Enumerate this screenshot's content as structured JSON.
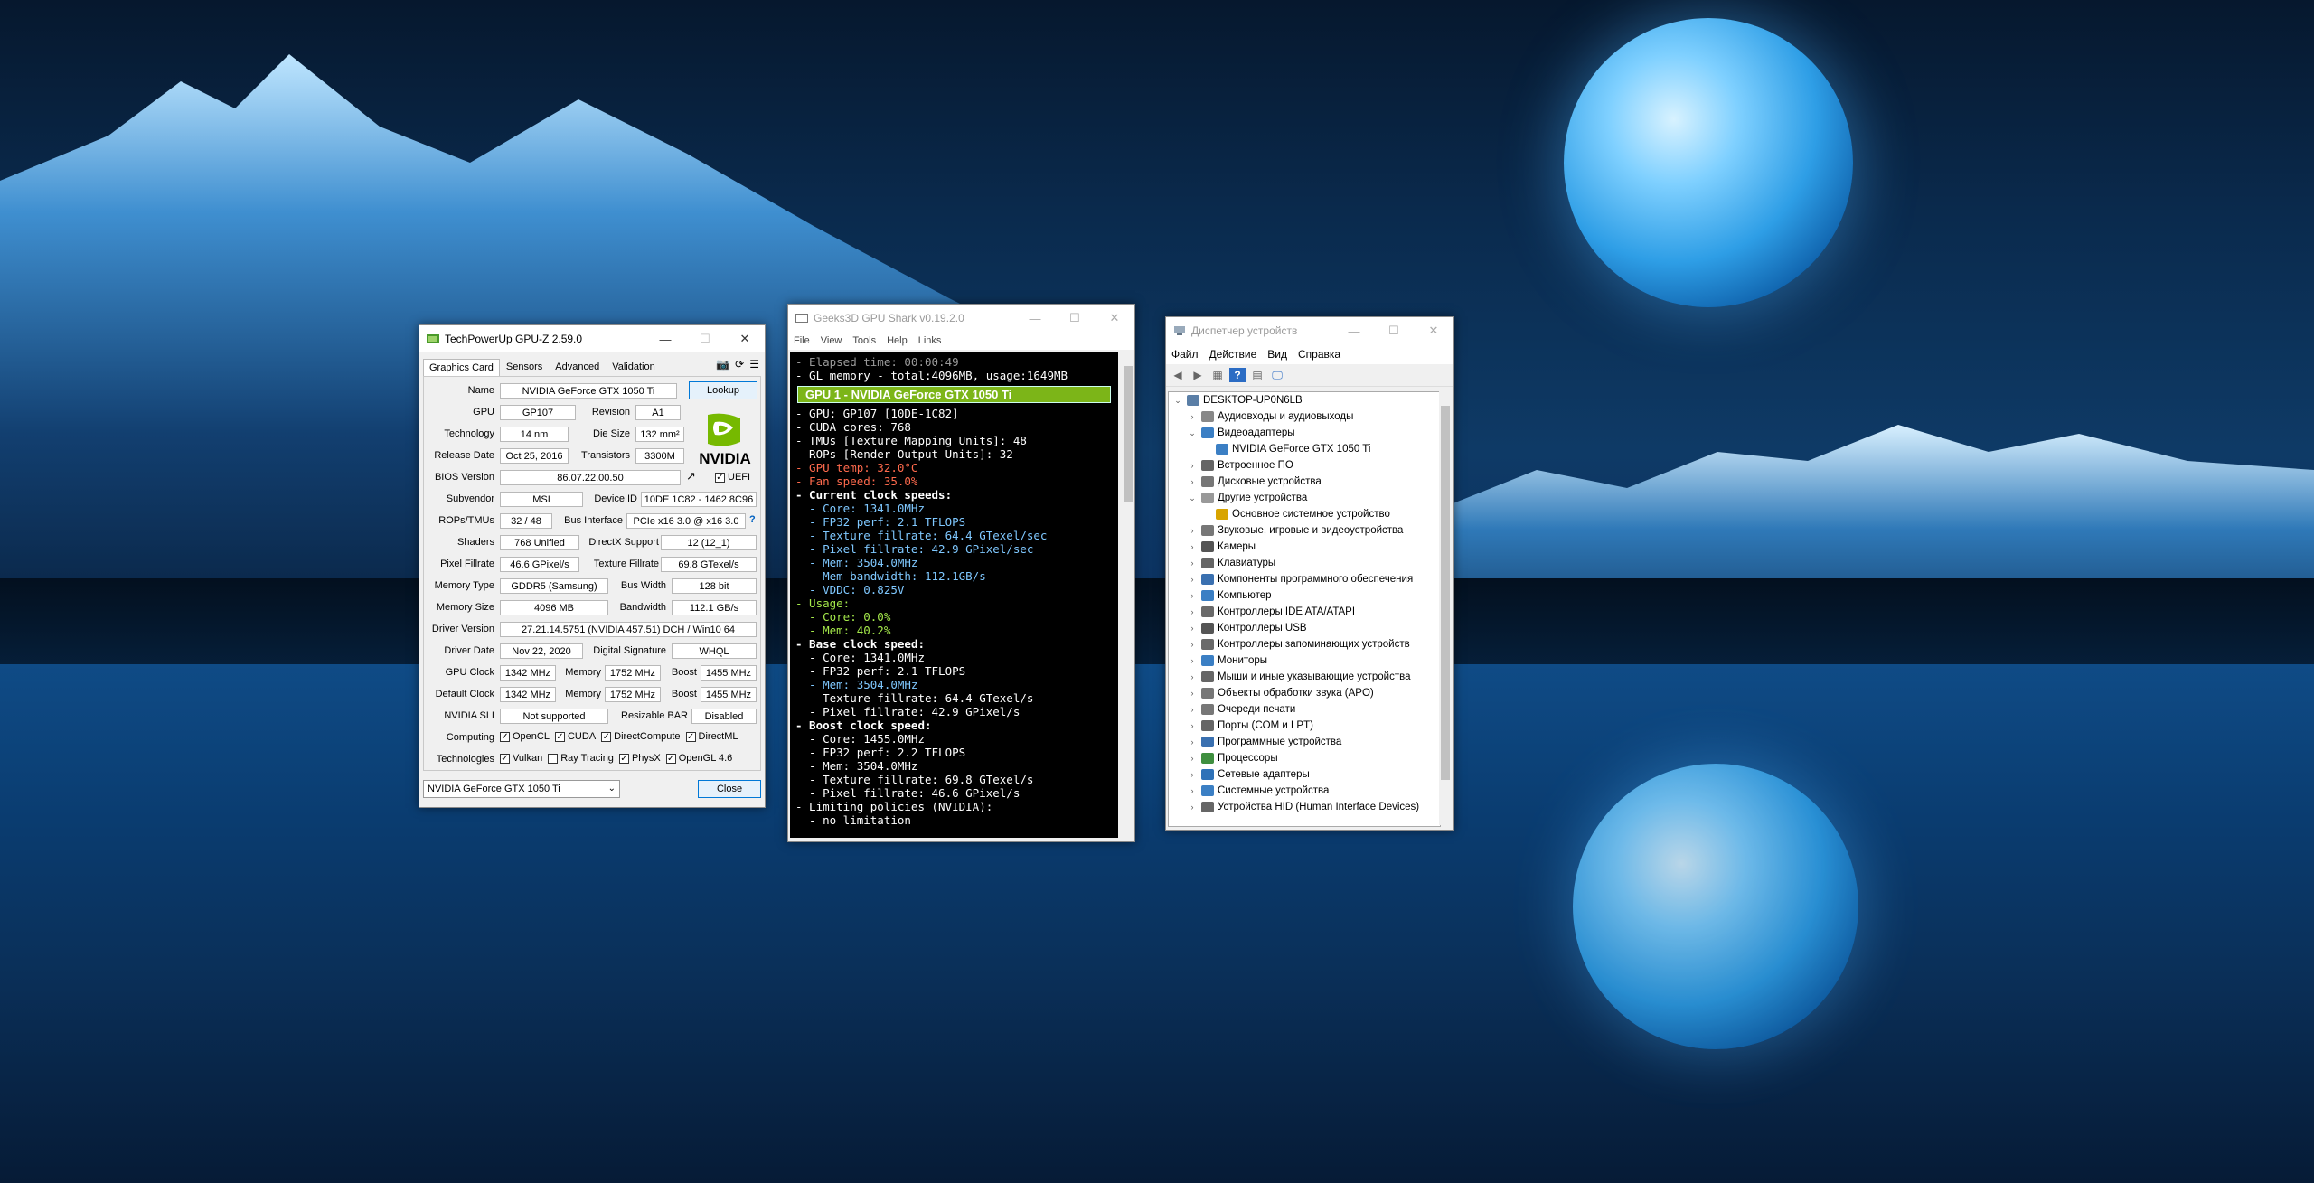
{
  "gpuz": {
    "title": "TechPowerUp GPU-Z 2.59.0",
    "tabs": [
      "Graphics Card",
      "Sensors",
      "Advanced",
      "Validation"
    ],
    "lookup_label": "Lookup",
    "logo_text": "NVIDIA",
    "fields": {
      "name_label": "Name",
      "name": "NVIDIA GeForce GTX 1050 Ti",
      "gpu_label": "GPU",
      "gpu": "GP107",
      "revision_label": "Revision",
      "revision": "A1",
      "technology_label": "Technology",
      "technology": "14 nm",
      "die_size_label": "Die Size",
      "die_size": "132 mm²",
      "release_label": "Release Date",
      "release": "Oct 25, 2016",
      "transistors_label": "Transistors",
      "transistors": "3300M",
      "bios_label": "BIOS Version",
      "bios": "86.07.22.00.50",
      "uefi_label": "UEFI",
      "subvendor_label": "Subvendor",
      "subvendor": "MSI",
      "device_id_label": "Device ID",
      "device_id": "10DE 1C82 - 1462 8C96",
      "rops_label": "ROPs/TMUs",
      "rops": "32 / 48",
      "bus_label": "Bus Interface",
      "bus": "PCIe x16 3.0 @ x16 3.0",
      "help_glyph": "?",
      "shaders_label": "Shaders",
      "shaders": "768 Unified",
      "directx_label": "DirectX Support",
      "directx": "12 (12_1)",
      "pixel_label": "Pixel Fillrate",
      "pixel": "46.6 GPixel/s",
      "texture_label": "Texture Fillrate",
      "texture": "69.8 GTexel/s",
      "memtype_label": "Memory Type",
      "memtype": "GDDR5 (Samsung)",
      "buswidth_label": "Bus Width",
      "buswidth": "128 bit",
      "memsize_label": "Memory Size",
      "memsize": "4096 MB",
      "bandwidth_label": "Bandwidth",
      "bandwidth": "112.1 GB/s",
      "driver_label": "Driver Version",
      "driver": "27.21.14.5751 (NVIDIA 457.51) DCH / Win10 64",
      "driverdate_label": "Driver Date",
      "driverdate": "Nov 22, 2020",
      "digsig_label": "Digital Signature",
      "digsig": "WHQL",
      "gpuclock_label": "GPU Clock",
      "gpuclock": "1342 MHz",
      "memory_label": "Memory",
      "memclock": "1752 MHz",
      "boost_label": "Boost",
      "boost": "1455 MHz",
      "defclock_label": "Default Clock",
      "defclock": "1342 MHz",
      "defmem": "1752 MHz",
      "defboost": "1455 MHz",
      "sli_label": "NVIDIA SLI",
      "sli": "Not supported",
      "bar_label": "Resizable BAR",
      "bar": "Disabled",
      "computing_label": "Computing",
      "technologies_label": "Technologies"
    },
    "computing": [
      {
        "label": "OpenCL",
        "checked": true
      },
      {
        "label": "CUDA",
        "checked": true
      },
      {
        "label": "DirectCompute",
        "checked": true
      },
      {
        "label": "DirectML",
        "checked": true
      }
    ],
    "technologies": [
      {
        "label": "Vulkan",
        "checked": true
      },
      {
        "label": "Ray Tracing",
        "checked": false
      },
      {
        "label": "PhysX",
        "checked": true
      },
      {
        "label": "OpenGL 4.6",
        "checked": true
      }
    ],
    "select_value": "NVIDIA GeForce GTX 1050 Ti",
    "close_label": "Close"
  },
  "shark": {
    "title": "Geeks3D GPU Shark v0.19.2.0",
    "menu": [
      "File",
      "View",
      "Tools",
      "Help",
      "Links"
    ],
    "lines_top": [
      {
        "text": "- Elapsed time: 00:00:49",
        "color": "#9a9a9a"
      },
      {
        "text": "- GL memory - total:4096MB, usage:1649MB",
        "color": "#ffffff"
      }
    ],
    "banner": "GPU 1 - NVIDIA GeForce GTX 1050 Ti",
    "lines": [
      {
        "text": "- GPU: GP107 [10DE-1C82]",
        "color": "#ffffff"
      },
      {
        "text": "- CUDA cores: 768",
        "color": "#ffffff"
      },
      {
        "text": "- TMUs [Texture Mapping Units]: 48",
        "color": "#ffffff"
      },
      {
        "text": "- ROPs [Render Output Units]: 32",
        "color": "#ffffff"
      },
      {
        "text": "- GPU temp: 32.0°C",
        "color": "#ff6a4d"
      },
      {
        "text": "- Fan speed: 35.0%",
        "color": "#ff6a4d"
      },
      {
        "text": "- Current clock speeds:",
        "color": "#ffffff",
        "bold": true
      },
      {
        "text": "  - Core: 1341.0MHz",
        "color": "#7fc8ff"
      },
      {
        "text": "  - FP32 perf: 2.1 TFLOPS",
        "color": "#7fc8ff"
      },
      {
        "text": "  - Texture fillrate: 64.4 GTexel/sec",
        "color": "#7fc8ff"
      },
      {
        "text": "  - Pixel fillrate: 42.9 GPixel/sec",
        "color": "#7fc8ff"
      },
      {
        "text": "  - Mem: 3504.0MHz",
        "color": "#7fc8ff"
      },
      {
        "text": "  - Mem bandwidth: 112.1GB/s",
        "color": "#7fc8ff"
      },
      {
        "text": "  - VDDC: 0.825V",
        "color": "#7fc8ff"
      },
      {
        "text": "- Usage:",
        "color": "#a4e84a"
      },
      {
        "text": "  - Core: 0.0%",
        "color": "#a4e84a"
      },
      {
        "text": "  - Mem: 40.2%",
        "color": "#a4e84a"
      },
      {
        "text": "- Base clock speed:",
        "color": "#ffffff",
        "bold": true
      },
      {
        "text": "  - Core: 1341.0MHz",
        "color": "#ffffff"
      },
      {
        "text": "  - FP32 perf: 2.1 TFLOPS",
        "color": "#ffffff"
      },
      {
        "text": "  - Mem: 3504.0MHz",
        "color": "#7fc8ff"
      },
      {
        "text": "  - Texture fillrate: 64.4 GTexel/s",
        "color": "#ffffff"
      },
      {
        "text": "  - Pixel fillrate: 42.9 GPixel/s",
        "color": "#ffffff"
      },
      {
        "text": "- Boost clock speed:",
        "color": "#ffffff",
        "bold": true
      },
      {
        "text": "  - Core: 1455.0MHz",
        "color": "#ffffff"
      },
      {
        "text": "  - FP32 perf: 2.2 TFLOPS",
        "color": "#ffffff"
      },
      {
        "text": "  - Mem: 3504.0MHz",
        "color": "#ffffff"
      },
      {
        "text": "  - Texture fillrate: 69.8 GTexel/s",
        "color": "#ffffff"
      },
      {
        "text": "  - Pixel fillrate: 46.6 GPixel/s",
        "color": "#ffffff"
      },
      {
        "text": "- Limiting policies (NVIDIA):",
        "color": "#ffffff"
      },
      {
        "text": "  - no limitation",
        "color": "#ffffff"
      }
    ]
  },
  "devmgr": {
    "title": "Диспетчер устройств",
    "menu": [
      "Файл",
      "Действие",
      "Вид",
      "Справка"
    ],
    "tree": [
      {
        "label": "DESKTOP-UP0N6LB",
        "level": 0,
        "exp": "v",
        "icon": "computer-icon"
      },
      {
        "label": "Аудиовходы и аудиовыходы",
        "level": 1,
        "exp": ">",
        "icon": "audio-icon"
      },
      {
        "label": "Видеоадаптеры",
        "level": 1,
        "exp": "v",
        "icon": "display-adapter-icon"
      },
      {
        "label": "NVIDIA GeForce GTX 1050 Ti",
        "level": 2,
        "exp": "",
        "icon": "display-adapter-icon"
      },
      {
        "label": "Встроенное ПО",
        "level": 1,
        "exp": ">",
        "icon": "firmware-icon"
      },
      {
        "label": "Дисковые устройства",
        "level": 1,
        "exp": ">",
        "icon": "disk-icon"
      },
      {
        "label": "Другие устройства",
        "level": 1,
        "exp": "v",
        "icon": "other-device-icon"
      },
      {
        "label": "Основное системное устройство",
        "level": 2,
        "exp": "",
        "icon": "warning-device-icon"
      },
      {
        "label": "Звуковые, игровые и видеоустройства",
        "level": 1,
        "exp": ">",
        "icon": "sound-icon"
      },
      {
        "label": "Камеры",
        "level": 1,
        "exp": ">",
        "icon": "camera-icon"
      },
      {
        "label": "Клавиатуры",
        "level": 1,
        "exp": ">",
        "icon": "keyboard-icon"
      },
      {
        "label": "Компоненты программного обеспечения",
        "level": 1,
        "exp": ">",
        "icon": "software-icon"
      },
      {
        "label": "Компьютер",
        "level": 1,
        "exp": ">",
        "icon": "monitor-icon"
      },
      {
        "label": "Контроллеры IDE ATA/ATAPI",
        "level": 1,
        "exp": ">",
        "icon": "ide-icon"
      },
      {
        "label": "Контроллеры USB",
        "level": 1,
        "exp": ">",
        "icon": "usb-icon"
      },
      {
        "label": "Контроллеры запоминающих устройств",
        "level": 1,
        "exp": ">",
        "icon": "storage-icon"
      },
      {
        "label": "Мониторы",
        "level": 1,
        "exp": ">",
        "icon": "monitor-icon"
      },
      {
        "label": "Мыши и иные указывающие устройства",
        "level": 1,
        "exp": ">",
        "icon": "mouse-icon"
      },
      {
        "label": "Объекты обработки звука (APO)",
        "level": 1,
        "exp": ">",
        "icon": "sound-icon"
      },
      {
        "label": "Очереди печати",
        "level": 1,
        "exp": ">",
        "icon": "printer-icon"
      },
      {
        "label": "Порты (COM и LPT)",
        "level": 1,
        "exp": ">",
        "icon": "port-icon"
      },
      {
        "label": "Программные устройства",
        "level": 1,
        "exp": ">",
        "icon": "software-icon"
      },
      {
        "label": "Процессоры",
        "level": 1,
        "exp": ">",
        "icon": "cpu-icon"
      },
      {
        "label": "Сетевые адаптеры",
        "level": 1,
        "exp": ">",
        "icon": "network-icon"
      },
      {
        "label": "Системные устройства",
        "level": 1,
        "exp": ">",
        "icon": "system-icon"
      },
      {
        "label": "Устройства HID (Human Interface Devices)",
        "level": 1,
        "exp": ">",
        "icon": "hid-icon"
      }
    ]
  },
  "colors": {
    "nvidia_green": "#76b900",
    "banner_green": "#7cb518",
    "accent_blue": "#0078d7"
  }
}
